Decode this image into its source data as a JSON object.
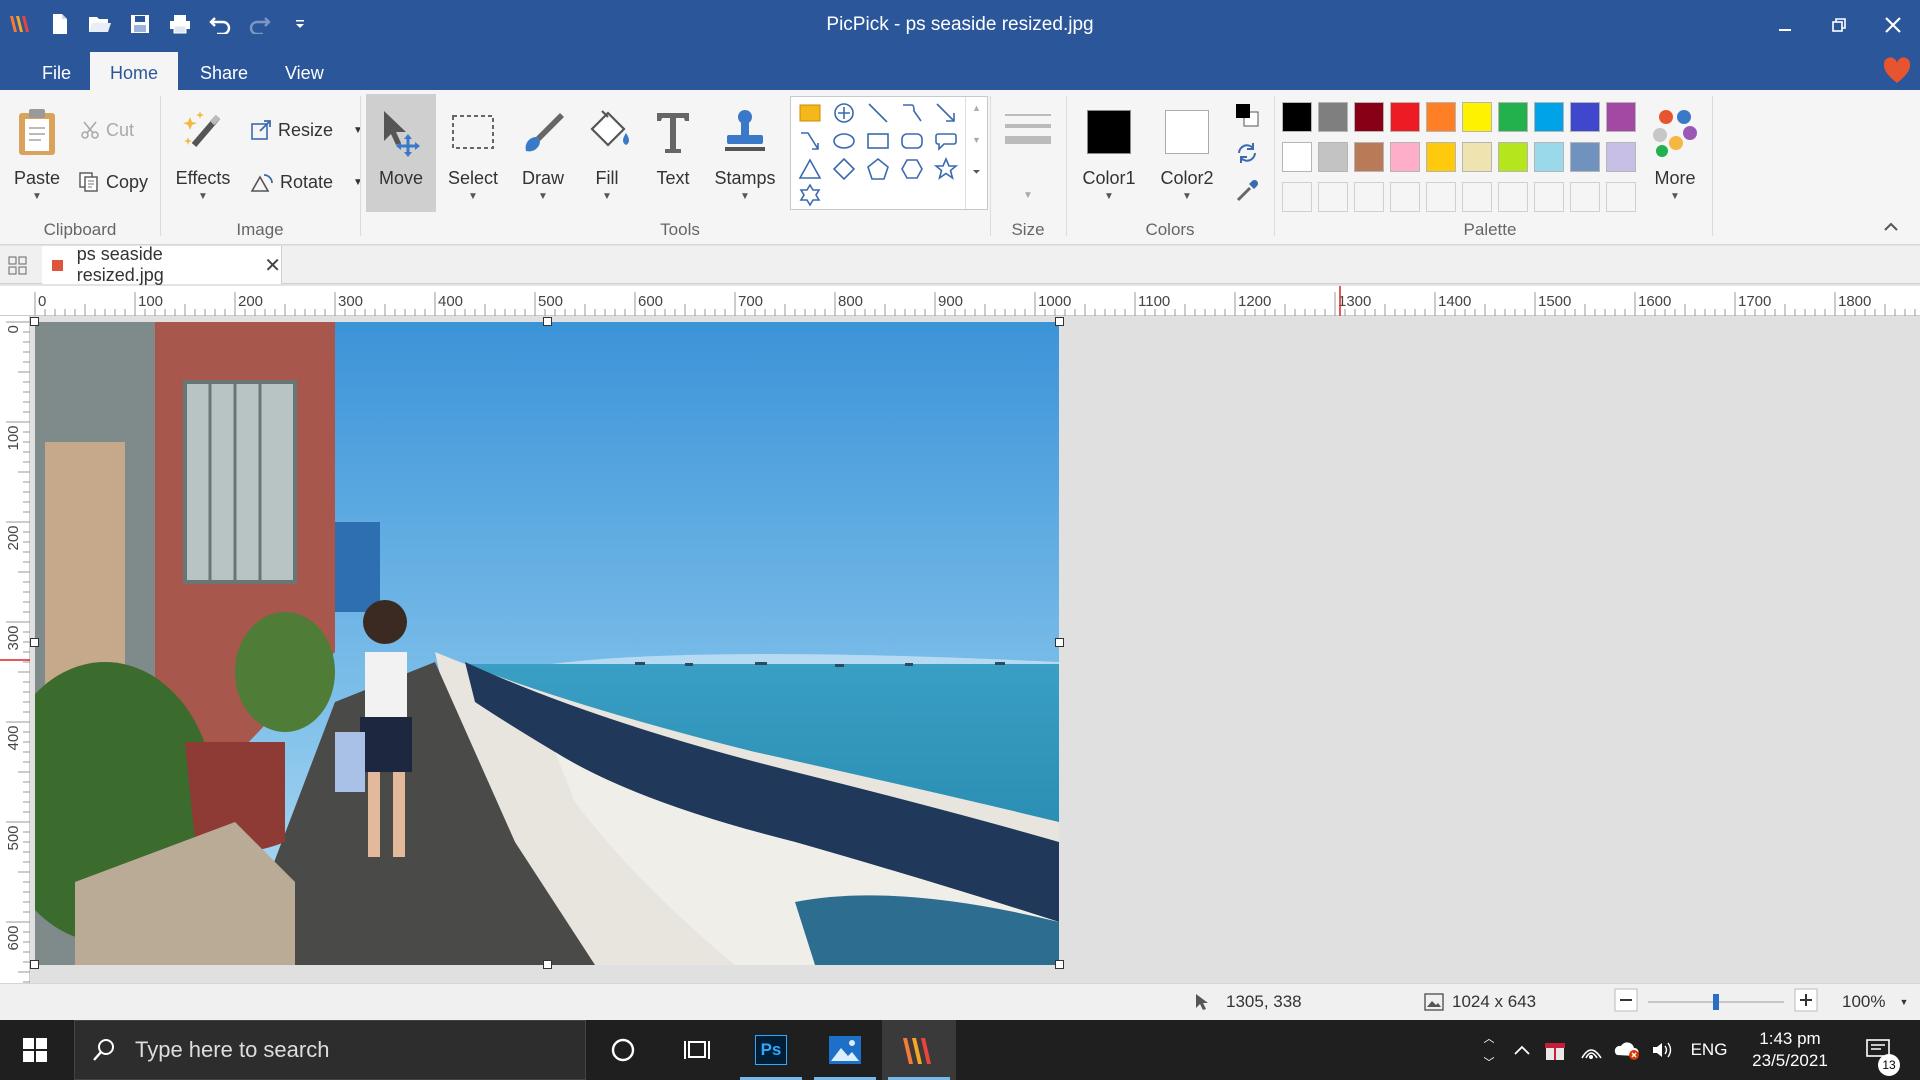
{
  "app": {
    "title": "PicPick - ps seaside resized.jpg"
  },
  "tabs": [
    "File",
    "Home",
    "Share",
    "View"
  ],
  "ribbon": {
    "paste": "Paste",
    "cut": "Cut",
    "copy": "Copy",
    "effects": "Effects",
    "resize": "Resize",
    "rotate": "Rotate",
    "move": "Move",
    "select": "Select",
    "draw": "Draw",
    "fill": "Fill",
    "text": "Text",
    "stamps": "Stamps",
    "color1": "Color1",
    "color2": "Color2",
    "more": "More",
    "groups": {
      "clipboard": "Clipboard",
      "image": "Image",
      "tools": "Tools",
      "size": "Size",
      "colors": "Colors",
      "palette": "Palette"
    }
  },
  "colors": {
    "brand": "#2b579a",
    "color1": "#000000",
    "color2": "#ffffff",
    "palette_row1": [
      "#000000",
      "#7f7f7f",
      "#880015",
      "#ed1c24",
      "#ff7f27",
      "#fff200",
      "#22b14c",
      "#00a2e8",
      "#3f48cc",
      "#a349a4"
    ],
    "palette_row2": [
      "#ffffff",
      "#c3c3c3",
      "#b97a57",
      "#ffaec9",
      "#ffc90e",
      "#efe4b0",
      "#b5e61d",
      "#99d9ea",
      "#7092be",
      "#c8bfe7"
    ]
  },
  "document": {
    "tab_name": "ps seaside resized.jpg"
  },
  "rulers": {
    "horizontal": [
      "0",
      "100",
      "200",
      "300",
      "400",
      "500",
      "600",
      "700",
      "800",
      "900",
      "1000",
      "1100",
      "1200",
      "1300",
      "1400",
      "1500",
      "1600",
      "1700",
      "1800"
    ],
    "vertical": [
      "0",
      "100",
      "200",
      "300",
      "400",
      "500",
      "600"
    ]
  },
  "status": {
    "cursor": "1305, 338",
    "image_size": "1024 x 643",
    "zoom": "100%",
    "zoom_level": 0.5
  },
  "taskbar": {
    "search_placeholder": "Type here to search",
    "language": "ENG",
    "time": "1:43 pm",
    "date": "23/5/2021",
    "notification_count": "13",
    "ps_label": "Ps"
  }
}
